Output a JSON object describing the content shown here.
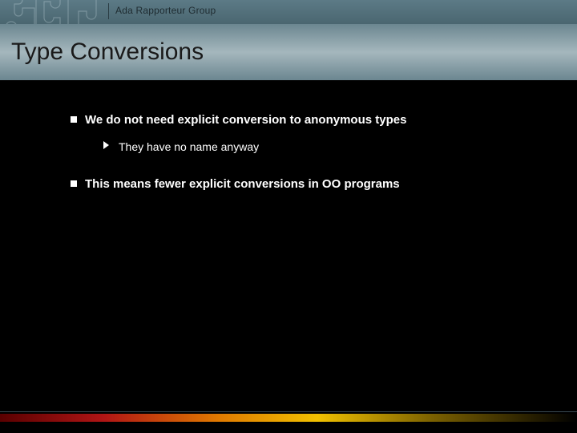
{
  "header": {
    "group_label": "Ada Rapporteur Group"
  },
  "title": "Type Conversions",
  "bullets": [
    {
      "text": "We do not need explicit conversion to anonymous types",
      "sub": [
        {
          "text": "They have no name anyway"
        }
      ]
    },
    {
      "text": " This means fewer explicit conversions in OO programs",
      "sub": []
    }
  ]
}
